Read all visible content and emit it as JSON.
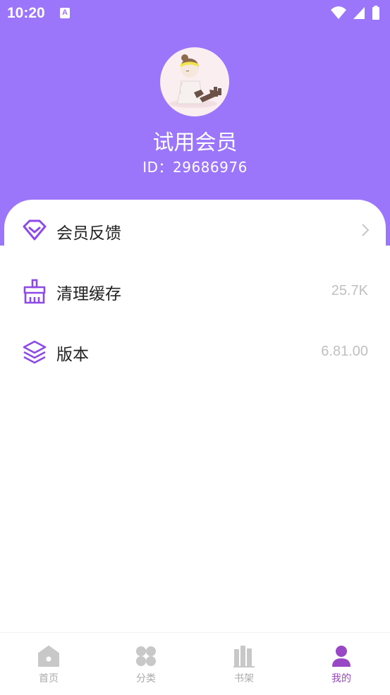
{
  "status_bar": {
    "time": "10:20",
    "badge": "A"
  },
  "profile": {
    "name": "试用会员",
    "id_label": "ID：",
    "id_value": "29686976",
    "avatar_icon": "avatar-illustration"
  },
  "menu": [
    {
      "label": "会员反馈",
      "value": "",
      "icon": "heart-diamond-icon",
      "has_arrow": true
    },
    {
      "label": "清理缓存",
      "value": "25.7K",
      "icon": "broom-icon"
    },
    {
      "label": "版本",
      "value": "6.81.00",
      "icon": "layers-icon"
    }
  ],
  "tabbar": [
    {
      "label": "首页",
      "icon": "home-icon"
    },
    {
      "label": "分类",
      "icon": "grid-icon"
    },
    {
      "label": "书架",
      "icon": "bookshelf-icon"
    },
    {
      "label": "我的",
      "icon": "person-icon",
      "active": true
    }
  ],
  "colors": {
    "header": "#9b76fb",
    "accent": "#8e4ae6",
    "active_tab": "#9848c4",
    "inactive_tab": "#c8c8c8"
  }
}
